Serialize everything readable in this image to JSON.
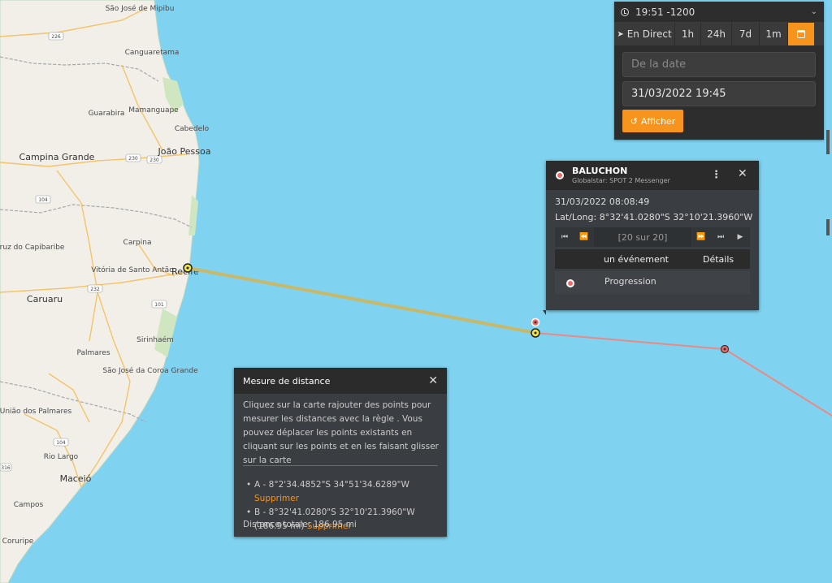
{
  "map": {
    "cities": [
      "São José de Mipibu",
      "Canguaretama",
      "Guarabira",
      "Mamanguape",
      "Cabedelo",
      "João Pessoa",
      "Campina Grande",
      "Santa Cruz do Capibaribe",
      "Carpina",
      "Vitória de Santo Antão",
      "Recife",
      "Caruaru",
      "Sirinhaém",
      "Palmares",
      "São José da Coroa Grande",
      "União dos Palmares",
      "Rio Largo",
      "Maceió",
      "Campos",
      "Coruripe"
    ],
    "highways": [
      "226",
      "230",
      "230",
      "104",
      "232",
      "101",
      "104",
      "316"
    ]
  },
  "time_panel": {
    "current": "19:51 -1200",
    "tabs": [
      "En Direct",
      "1h",
      "24h",
      "7d",
      "1m"
    ],
    "from_placeholder": "De la date",
    "to_value": "31/03/2022 19:45",
    "show_label": "Afficher"
  },
  "device": {
    "name": "BALUCHON",
    "subtitle": "Globalstar: SPOT 2 Messenger",
    "timestamp": "31/03/2022 08:08:49",
    "latlong_label": "Lat/Long:",
    "latlong_value": "8°32'41.0280\"S 32°10'21.3960\"W",
    "counter": "[20 sur 20]",
    "event_col": "un événement",
    "details_col": "Détails",
    "event": "Progression"
  },
  "distance": {
    "title": "Mesure de distance",
    "instructions": "Cliquez sur la carte rajouter des points pour mesurer les distances avec la règle . Vous pouvez déplacer les points existants en cliquant sur les points et en les faisant glisser sur la carte",
    "point_a": "A - 8°2'34.4852\"S 34°51'34.6289\"W",
    "point_b": "B - 8°32'41.0280\"S 32°10'21.3960\"W (186.95 mi)",
    "delete_label": "Supprimer",
    "total": "Distance totale: 186.95 mi"
  },
  "colors": {
    "ocean": "#7fd3f0",
    "land": "#f2efe9",
    "accent": "#f7941d",
    "track": "#e88a86",
    "ruler": "#c8b86a"
  }
}
